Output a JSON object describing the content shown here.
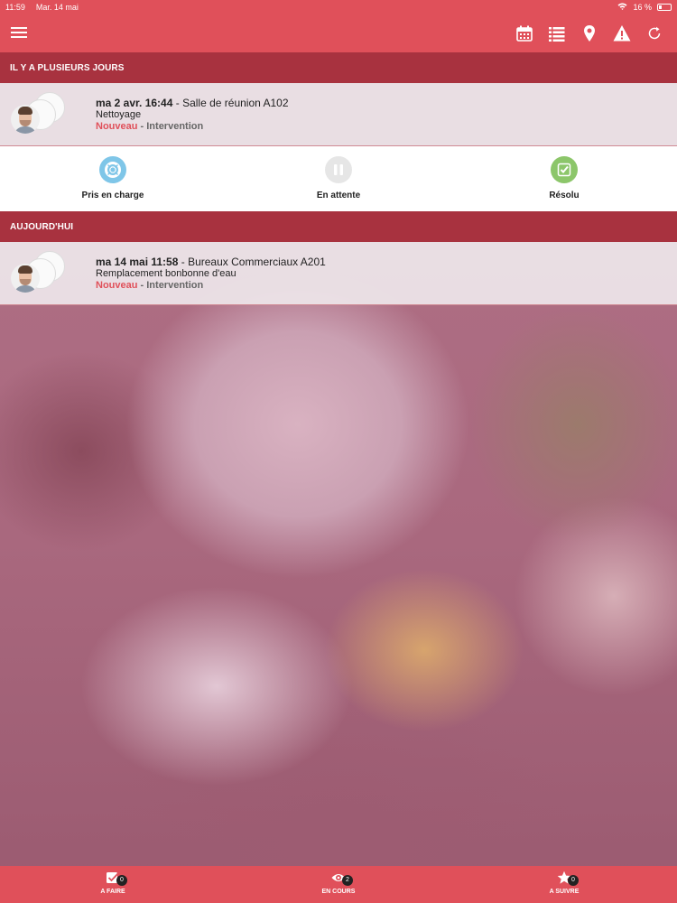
{
  "status_bar": {
    "time": "11:59",
    "date": "Mar. 14 mai",
    "battery": "16 %"
  },
  "sections": [
    {
      "header": "IL Y A PLUSIEURS JOURS",
      "ticket": {
        "date": "ma 2 avr. 16:44",
        "separator": " - ",
        "location": "Salle de réunion A102",
        "subject": "Nettoyage",
        "status": "Nouveau",
        "type_separator": " - ",
        "type": "Intervention"
      }
    },
    {
      "header": "AUJOURD'HUI",
      "ticket": {
        "date": "ma 14 mai 11:58",
        "separator": " - ",
        "location": "Bureaux Commerciaux A201",
        "subject": "Remplacement bonbonne d'eau",
        "status": "Nouveau",
        "type_separator": " - ",
        "type": "Intervention"
      }
    }
  ],
  "actions": [
    {
      "label": "Pris en charge",
      "icon": "lifebuoy-icon",
      "color": "#7fc6e8"
    },
    {
      "label": "En attente",
      "icon": "pause-icon",
      "color": "#e6e6e6"
    },
    {
      "label": "Résolu",
      "icon": "check-icon",
      "color": "#8cc66a"
    }
  ],
  "tabs": [
    {
      "label": "A FAIRE",
      "count": "0",
      "icon": "checkbox-icon"
    },
    {
      "label": "EN COURS",
      "count": "2",
      "icon": "eye-icon"
    },
    {
      "label": "A SUIVRE",
      "count": "0",
      "icon": "star-icon"
    }
  ],
  "colors": {
    "primary": "#e0505a",
    "section": "#a8323f",
    "status_new": "#e0505a"
  }
}
